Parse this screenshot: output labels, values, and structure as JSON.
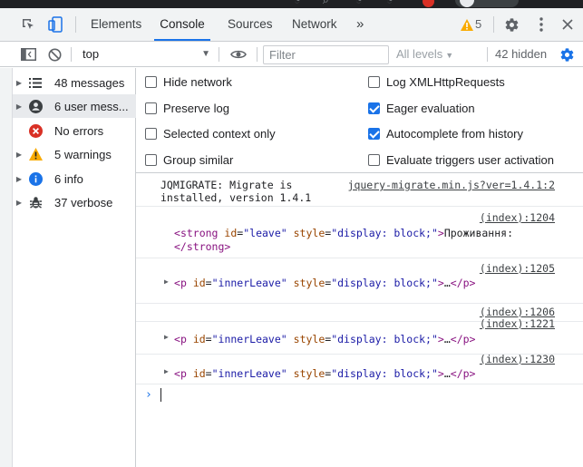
{
  "tabs": [
    {
      "label": "Elements"
    },
    {
      "label": "Console",
      "active": true
    },
    {
      "label": "Sources"
    },
    {
      "label": "Network"
    }
  ],
  "more_tabs_icon": "chevron-double-right-icon",
  "warnings_badge": "5",
  "toolbar": {
    "context": "top",
    "filter_placeholder": "Filter",
    "levels": "All levels",
    "hidden": "42 hidden"
  },
  "sidebar": {
    "items": [
      {
        "label": "48 messages",
        "icon": "list-icon"
      },
      {
        "label": "6 user mess...",
        "icon": "user-icon",
        "selected": true
      },
      {
        "label": "No errors",
        "icon": "error-icon"
      },
      {
        "label": "5 warnings",
        "icon": "warning-icon"
      },
      {
        "label": "6 info",
        "icon": "info-icon"
      },
      {
        "label": "37 verbose",
        "icon": "bug-icon"
      }
    ]
  },
  "settings": {
    "hide_network": {
      "label": "Hide network",
      "checked": false
    },
    "preserve_log": {
      "label": "Preserve log",
      "checked": false
    },
    "selected_context": {
      "label": "Selected context only",
      "checked": false
    },
    "group_similar": {
      "label": "Group similar",
      "checked": false
    },
    "log_xhr": {
      "label": "Log XMLHttpRequests",
      "checked": false
    },
    "eager_eval": {
      "label": "Eager evaluation",
      "checked": true
    },
    "autocomplete": {
      "label": "Autocomplete from history",
      "checked": true
    },
    "eval_triggers": {
      "label": "Evaluate triggers user activation",
      "checked": false
    }
  },
  "messages": {
    "m1": {
      "text_line1": "JQMIGRATE: Migrate is",
      "text_line2": "installed, version 1.4.1",
      "source": "jquery-migrate.min.js?ver=1.4.1:2"
    },
    "m2": {
      "source": "(index):1204",
      "open_tag": "strong",
      "id_attr": "id",
      "id_val": "\"leave\"",
      "style_attr": "style",
      "style_val": "\"display: block;\"",
      "content": "Проживання:",
      "close_tag": "</strong>"
    },
    "m3": {
      "source": "(index):1205",
      "tag": "p",
      "id_val": "\"innerLeave\"",
      "style_val": "\"display: block;\"",
      "ellipsis": "…",
      "close_tag": "</p>"
    },
    "m4": {
      "source": "(index):1206"
    },
    "m5": {
      "source": "(index):1221",
      "tag": "p",
      "id_val": "\"innerLeave\"",
      "style_val": "\"display: block;\"",
      "ellipsis": "…",
      "close_tag": "</p>"
    },
    "m6": {
      "source": "(index):1230",
      "tag": "p",
      "id_val": "\"innerLeave\"",
      "style_val": "\"display: block;\"",
      "ellipsis": "…",
      "close_tag": "</p>"
    }
  },
  "prompt_symbol": "›",
  "colors": {
    "accent": "#1a73e8",
    "error": "#d93025",
    "warning": "#f9ab00",
    "info": "#1a73e8"
  }
}
